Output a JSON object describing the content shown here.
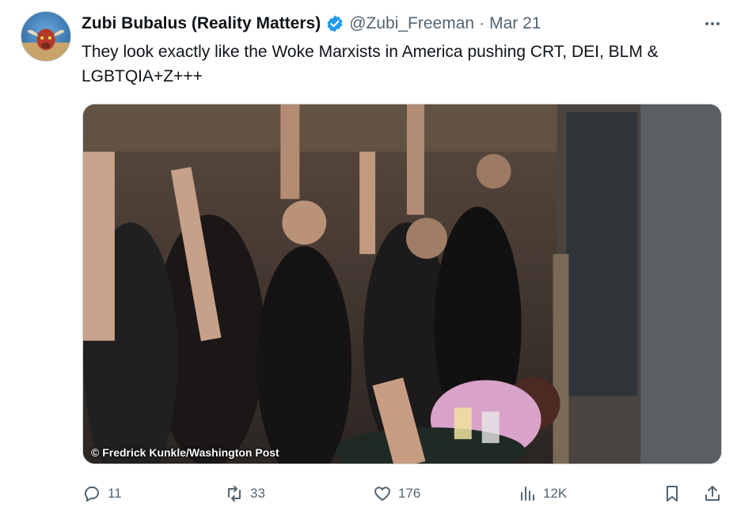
{
  "author": {
    "display_name": "Zubi Bubalus (Reality Matters)",
    "handle": "@Zubi_Freeman",
    "separator": "·",
    "date": "Mar 21",
    "verified_icon": "verified-badge-icon",
    "verified_color": "#1d9bf0"
  },
  "tweet": {
    "text": "They look exactly like the Woke Marxists in America pushing CRT, DEI, BLM & LGBTQIA+Z+++"
  },
  "media": {
    "credit": "© Fredrick Kunkle/Washington Post"
  },
  "actions": {
    "reply": {
      "icon": "reply-icon",
      "count": "11"
    },
    "retweet": {
      "icon": "retweet-icon",
      "count": "33"
    },
    "like": {
      "icon": "heart-icon",
      "count": "176"
    },
    "views": {
      "icon": "views-chart-icon",
      "count": "12K"
    },
    "bookmark": {
      "icon": "bookmark-icon"
    },
    "share": {
      "icon": "share-icon"
    }
  },
  "colors": {
    "text_primary": "#0f1419",
    "text_secondary": "#536471",
    "accent": "#1d9bf0"
  }
}
